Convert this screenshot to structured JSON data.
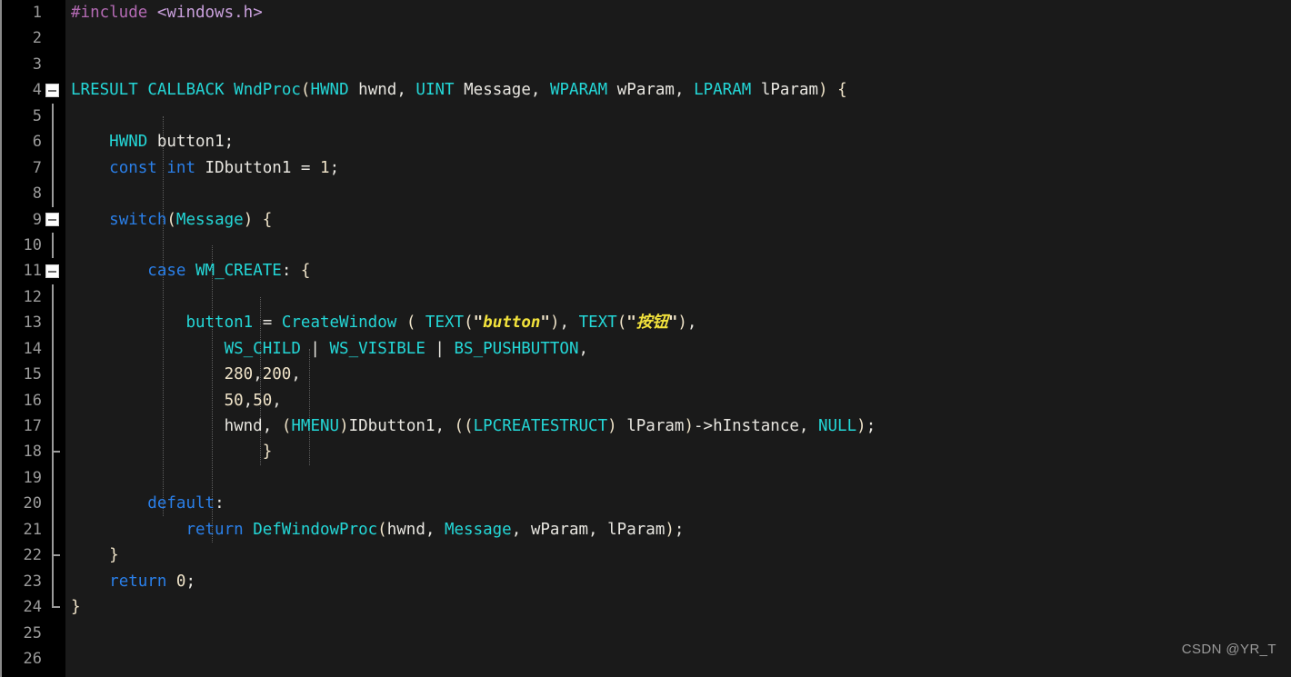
{
  "editor": {
    "background": "#1a1a1a",
    "gutter_background": "#000000",
    "total_lines": 26,
    "first_visible_line": 1
  },
  "watermark": {
    "text": "CSDN @YR_T"
  },
  "colors": {
    "preprocessor": "#b36ab3",
    "include_path": "#c9a0dc",
    "keyword": "#2a7fe8",
    "type": "#24d7d7",
    "identifier": "#e8e6e0",
    "number": "#efe3c8",
    "string": "#f2e23c",
    "brace": "#efe3c8",
    "line_number": "#9b9b9b",
    "indent_guide": "#5e5e5e",
    "fold_marker": "#fdfdfd"
  },
  "gutter": {
    "line_numbers": [
      "1",
      "2",
      "3",
      "4",
      "5",
      "6",
      "7",
      "8",
      "9",
      "10",
      "11",
      "12",
      "13",
      "14",
      "15",
      "16",
      "17",
      "18",
      "19",
      "20",
      "21",
      "22",
      "23",
      "24",
      "25",
      "26"
    ],
    "fold_markers": [
      {
        "line": 4,
        "type": "collapse-box"
      },
      {
        "line": 9,
        "type": "collapse-box"
      },
      {
        "line": 11,
        "type": "collapse-box"
      },
      {
        "line": 18,
        "type": "fold-end-tick"
      },
      {
        "line": 22,
        "type": "fold-end-tick"
      },
      {
        "line": 24,
        "type": "fold-end-tick"
      }
    ]
  },
  "code": {
    "language": "C",
    "lines": [
      {
        "n": 1,
        "text": "#include <windows.h>"
      },
      {
        "n": 2,
        "text": ""
      },
      {
        "n": 3,
        "text": ""
      },
      {
        "n": 4,
        "text": "LRESULT CALLBACK WndProc(HWND hwnd, UINT Message, WPARAM wParam, LPARAM lParam) {"
      },
      {
        "n": 5,
        "text": ""
      },
      {
        "n": 6,
        "text": "    HWND button1;"
      },
      {
        "n": 7,
        "text": "    const int IDbutton1 = 1;"
      },
      {
        "n": 8,
        "text": ""
      },
      {
        "n": 9,
        "text": "    switch(Message) {"
      },
      {
        "n": 10,
        "text": ""
      },
      {
        "n": 11,
        "text": "        case WM_CREATE: {"
      },
      {
        "n": 12,
        "text": ""
      },
      {
        "n": 13,
        "text": "            button1 = CreateWindow ( TEXT(\"button\"), TEXT(\"按钮\"),"
      },
      {
        "n": 14,
        "text": "                WS_CHILD | WS_VISIBLE | BS_PUSHBUTTON,"
      },
      {
        "n": 15,
        "text": "                280,200,"
      },
      {
        "n": 16,
        "text": "                50,50,"
      },
      {
        "n": 17,
        "text": "                hwnd, (HMENU)IDbutton1, ((LPCREATESTRUCT) lParam)->hInstance, NULL);"
      },
      {
        "n": 18,
        "text": "                    }"
      },
      {
        "n": 19,
        "text": ""
      },
      {
        "n": 20,
        "text": "        default:"
      },
      {
        "n": 21,
        "text": "            return DefWindowProc(hwnd, Message, wParam, lParam);"
      },
      {
        "n": 22,
        "text": "    }"
      },
      {
        "n": 23,
        "text": "    return 0;"
      },
      {
        "n": 24,
        "text": "}"
      },
      {
        "n": 25,
        "text": ""
      },
      {
        "n": 26,
        "text": ""
      }
    ]
  }
}
